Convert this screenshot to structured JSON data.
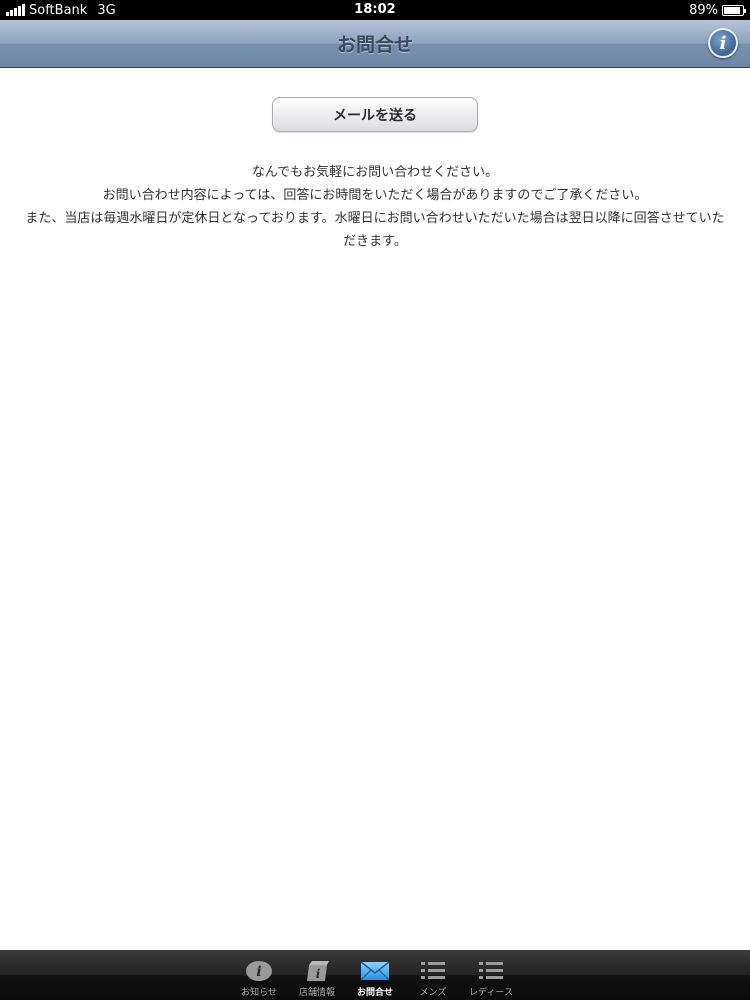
{
  "status_bar": {
    "carrier": "SoftBank",
    "network": "3G",
    "time": "18:02",
    "battery": "89%",
    "battery_level": 0.89
  },
  "nav": {
    "title": "お問合せ",
    "info_icon": "info-icon",
    "info_glyph": "i"
  },
  "main": {
    "mail_button_label": "メールを送る",
    "message_lines": [
      "なんでもお気軽にお問い合わせください。",
      "お問い合わせ内容によっては、回答にお時間をいただく場合がありますのでご了承ください。",
      "また、当店は毎週水曜日が定休日となっております。水曜日にお問い合わせいただいた場合は翌日以降に回答させていた",
      "だきます。"
    ]
  },
  "tabs": [
    {
      "label": "お知らせ",
      "icon": "info-icon",
      "active": false
    },
    {
      "label": "店舗情報",
      "icon": "store-info-icon",
      "active": false
    },
    {
      "label": "お問合せ",
      "icon": "envelope-icon",
      "active": true
    },
    {
      "label": "メンズ",
      "icon": "list-icon",
      "active": false
    },
    {
      "label": "レディース",
      "icon": "list-icon",
      "active": false
    }
  ],
  "colors": {
    "nav_bar": "#8ea2bc",
    "tab_bar": "#1a1a1a",
    "active_tab_icon": "#5ab0f0"
  }
}
